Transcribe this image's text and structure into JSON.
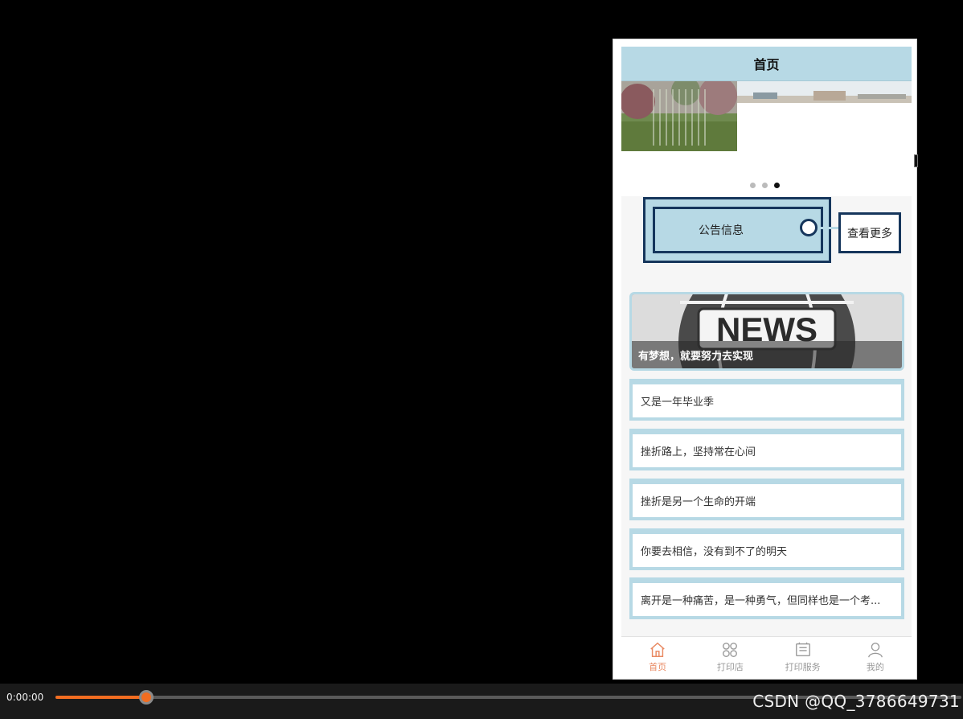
{
  "nav": {
    "title": "首页"
  },
  "banner": {
    "slide_count": 3,
    "active_index": 2
  },
  "notice": {
    "label": "公告信息",
    "more_label": "查看更多"
  },
  "news_card": {
    "image_text": "NEWS",
    "caption": "有梦想，就要努力去实现"
  },
  "articles": [
    "又是一年毕业季",
    "挫折路上，坚持常在心间",
    "挫折是另一个生命的开端",
    "你要去相信，没有到不了的明天",
    "离开是一种痛苦，是一种勇气，但同样也是一个考..."
  ],
  "tabs": [
    {
      "label": "首页",
      "icon": "home-icon",
      "active": true
    },
    {
      "label": "打印店",
      "icon": "grid-icon",
      "active": false
    },
    {
      "label": "打印服务",
      "icon": "print-service-icon",
      "active": false
    },
    {
      "label": "我的",
      "icon": "user-icon",
      "active": false
    }
  ],
  "player": {
    "time": "0:00:00",
    "progress": 0.1
  },
  "watermark": "CSDN @QQ_3786649731",
  "colors": {
    "accent": "#b7d9e5",
    "border_dark": "#16365c",
    "tab_active": "#e98a63",
    "progress": "#f26d21"
  }
}
